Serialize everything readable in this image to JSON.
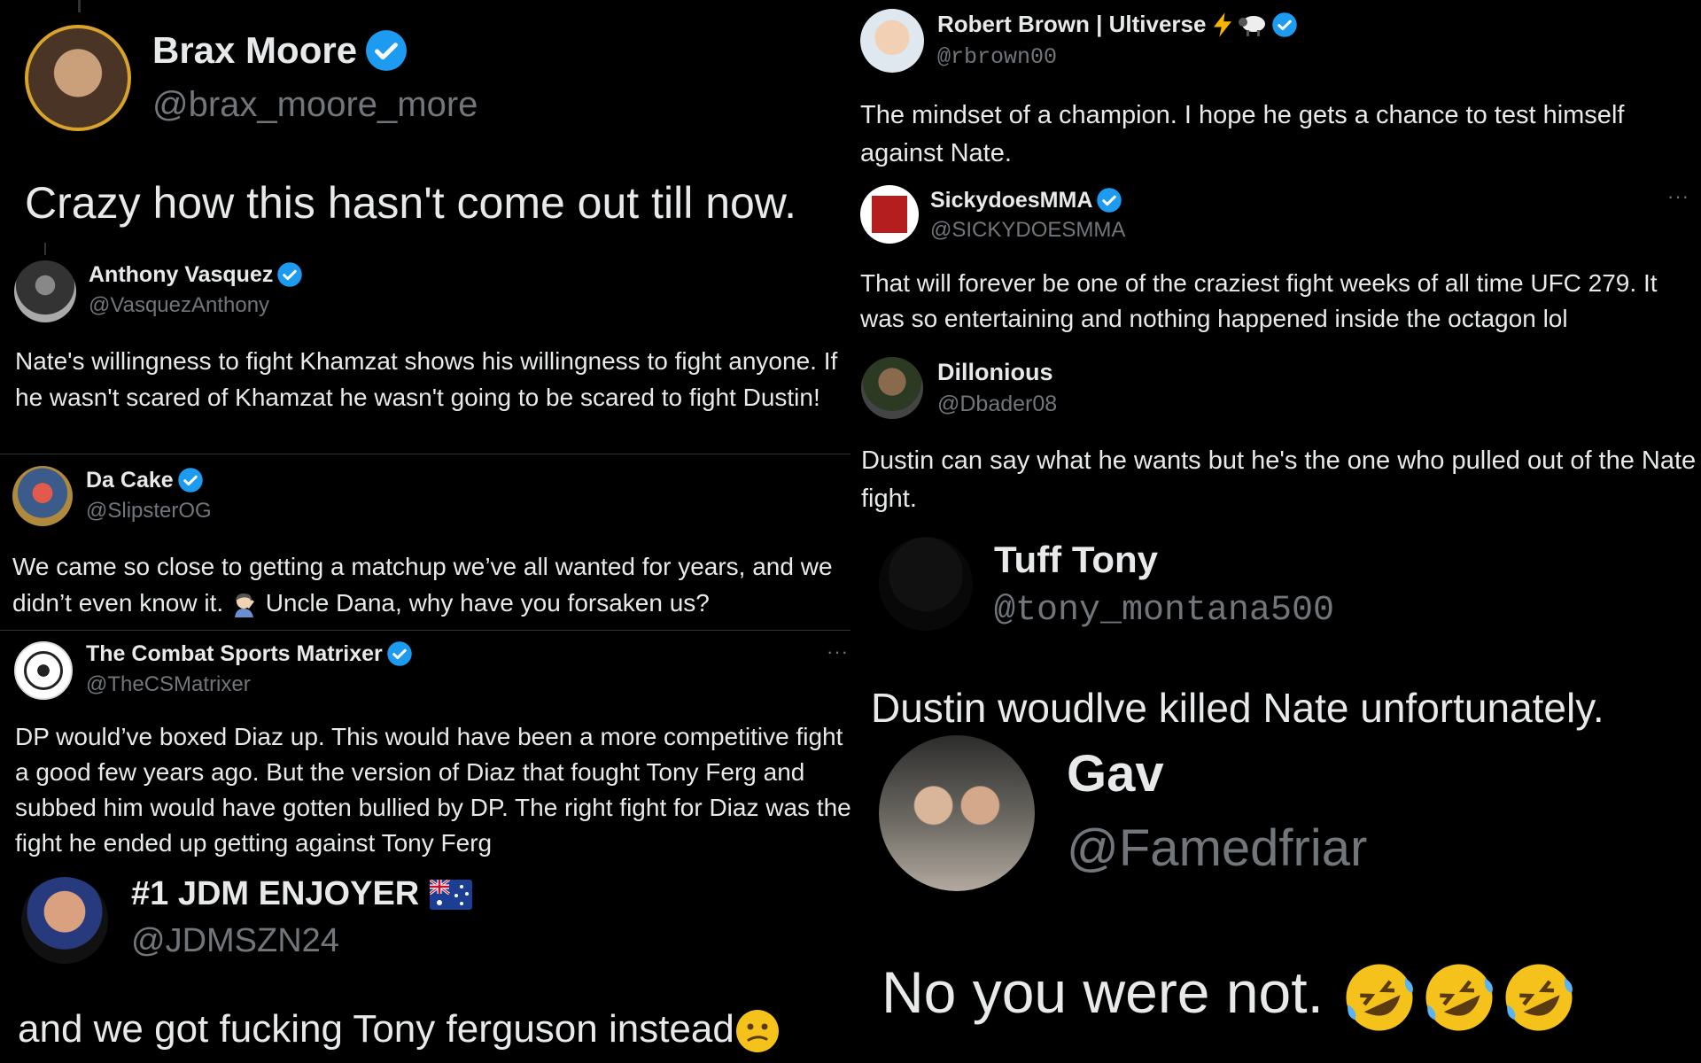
{
  "tweets": {
    "brax": {
      "name": "Brax Moore",
      "handle": "@brax_moore_more",
      "text": "Crazy how this hasn't come out till now."
    },
    "anthony": {
      "name": "Anthony Vasquez",
      "handle": "@VasquezAnthony",
      "text": "Nate's willingness to fight Khamzat shows his willingness to fight anyone. If he wasn't scared of Khamzat he wasn't going to be scared to fight Dustin!"
    },
    "dacake": {
      "name": "Da Cake",
      "handle": "@SlipsterOG",
      "text_a": "We came so close to getting a matchup we’ve all wanted for years, and we didn’t even know it.",
      "text_b": "Uncle Dana, why have you forsaken us?"
    },
    "matrixer": {
      "name": "The Combat Sports Matrixer",
      "handle": "@TheCSMatrixer",
      "text": "DP would’ve boxed Diaz up. This would have been a more competitive fight a good few years ago. But the version of Diaz that fought Tony Ferg and subbed him would have gotten bullied by DP. The right fight for Diaz was the fight he ended up getting against Tony Ferg",
      "more": "···"
    },
    "jdm": {
      "name": "#1 JDM ENJOYER",
      "handle": "@JDMSZN24",
      "text": "and we got fucking Tony ferguson instead"
    },
    "robert": {
      "name": "Robert Brown | Ultiverse",
      "handle": "@rbrown00",
      "text": "The mindset of a champion. I hope he gets a chance to test himself against Nate."
    },
    "sicky": {
      "name": "SickydoesMMA",
      "handle": "@SICKYDOESMMA",
      "text": "That will forever be one of the craziest fight weeks of all time UFC 279. It was so entertaining and nothing happened inside the octagon lol",
      "more": "···"
    },
    "dillonious": {
      "name": "Dillonious",
      "handle": "@Dbader08",
      "text": "Dustin can say what he wants but he's the one who pulled out of the Nate fight."
    },
    "tuff": {
      "name": "Tuff Tony",
      "handle": "@tony_montana500",
      "text": "Dustin woudlve killed Nate unfortunately."
    },
    "gav": {
      "name": "Gav",
      "handle": "@Famedfriar",
      "text": "No you were not."
    }
  },
  "icons": {
    "verified": "verified-badge-icon",
    "lightning": "lightning-emoji-icon",
    "sheep": "sheep-emoji-icon",
    "flag": "australia-flag-icon",
    "facepalm": "facepalm-emoji-icon",
    "confused": "confused-face-emoji-icon",
    "laughing": "rolling-laughing-emoji-icon"
  },
  "colors": {
    "background": "#000000",
    "text": "#e7e9ea",
    "muted": "#71767b",
    "verified": "#1d9bf0",
    "divider": "#2f3336"
  }
}
